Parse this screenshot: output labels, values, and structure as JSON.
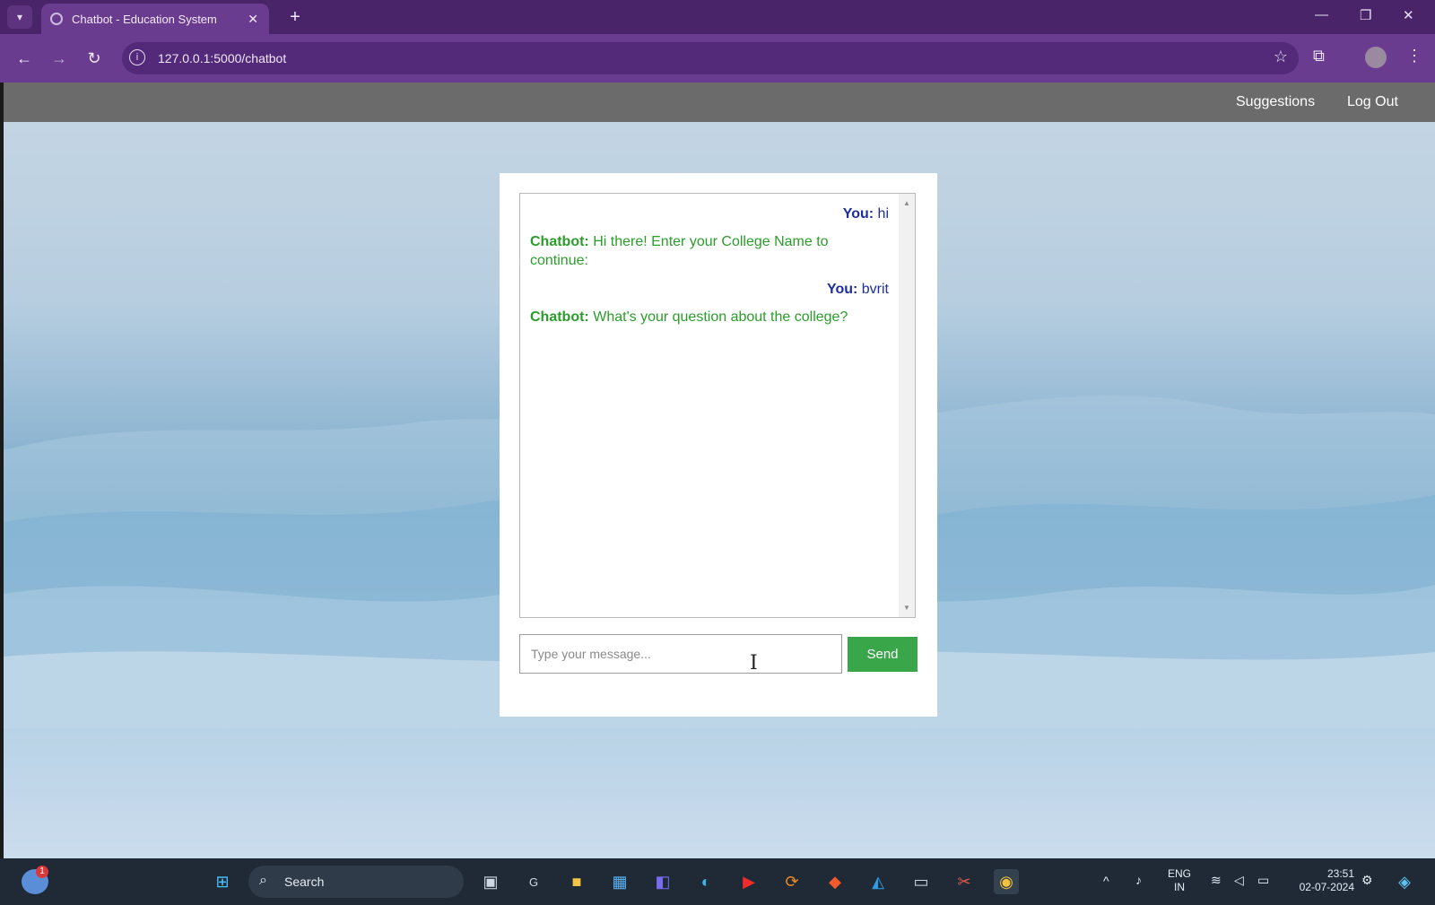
{
  "browser": {
    "tab_title": "Chatbot - Education System",
    "url": "127.0.0.1:5000/chatbot"
  },
  "navbar": {
    "links": [
      "Suggestions",
      "Log Out"
    ]
  },
  "chat": {
    "messages": [
      {
        "role": "user",
        "speaker": "You:",
        "text": "hi"
      },
      {
        "role": "bot",
        "speaker": "Chatbot:",
        "text": "Hi there! Enter your College Name to continue:"
      },
      {
        "role": "user",
        "speaker": "You:",
        "text": "bvrit"
      },
      {
        "role": "bot",
        "speaker": "Chatbot:",
        "text": "What's your question about the college?"
      }
    ],
    "input_placeholder": "Type your message...",
    "send_label": "Send",
    "colors": {
      "user": "#1f2f9a",
      "bot": "#2a9d2a",
      "send_button": "#3aa64a"
    }
  },
  "taskbar": {
    "search_label": "Search",
    "notification_count": "1",
    "language": [
      "ENG",
      "IN"
    ],
    "time": "23:51",
    "date": "02-07-2024",
    "apps": [
      "start-icon",
      "task-view-icon",
      "app-g-icon",
      "file-explorer-icon",
      "store-icon",
      "editor-icon",
      "edge-icon",
      "youtube-icon",
      "sync-icon",
      "brave-icon",
      "vscode-icon",
      "terminal-icon",
      "snipping-icon",
      "chrome-icon"
    ]
  }
}
